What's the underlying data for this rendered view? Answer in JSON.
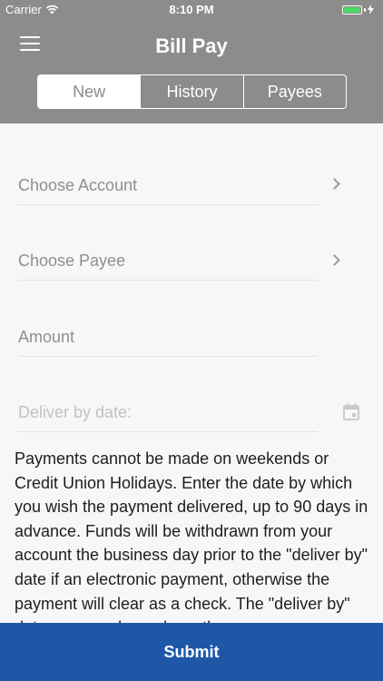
{
  "status_bar": {
    "carrier": "Carrier",
    "time": "8:10 PM",
    "battery_level": 1.0,
    "wifi_icon": "wifi-icon"
  },
  "nav": {
    "title": "Bill Pay",
    "menu_icon": "hamburger-menu-icon",
    "tabs": [
      {
        "label": "New",
        "active": true
      },
      {
        "label": "History",
        "active": false
      },
      {
        "label": "Payees",
        "active": false
      }
    ]
  },
  "form": {
    "account_placeholder": "Choose Account",
    "payee_placeholder": "Choose Payee",
    "amount_placeholder": "Amount",
    "date_placeholder": "Deliver by date:"
  },
  "note": "Payments cannot be made on weekends or Credit Union Holidays. Enter the date by which you wish the payment delivered, up to 90 days in advance. Funds will be withdrawn from your account the business day prior to the \"deliver by\" date if an electronic payment, otherwise the payment will clear as a check. The \"deliver by\" date you see depends on the payee.",
  "submit_label": "Submit",
  "colors": {
    "header": "#8c8c8c",
    "submit": "#1f57a7",
    "battery": "#4cd964"
  }
}
